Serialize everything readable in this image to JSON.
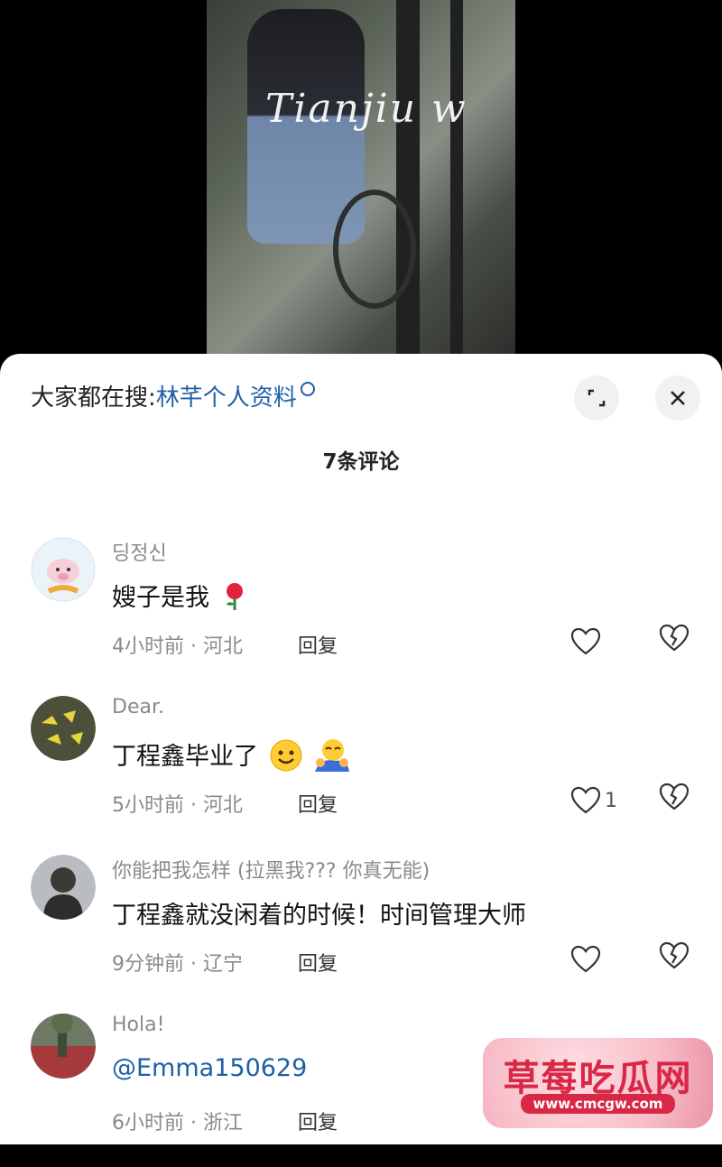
{
  "video": {
    "watermark": "Tianjiu w"
  },
  "sheet": {
    "search_prefix": "大家都在搜:",
    "search_term": "林芊个人资料",
    "expand_icon": "expand-icon",
    "close_icon": "close-icon",
    "comment_count_label": "7条评论"
  },
  "comments": [
    {
      "user": "딩정신",
      "text": "嫂子是我",
      "emoji": "rose",
      "meta": "4小时前 · 河北",
      "reply": "回复",
      "likes": ""
    },
    {
      "user": "Dear.",
      "text": "丁程鑫毕业了",
      "emoji": "grin-hug",
      "meta": "5小时前 · 河北",
      "reply": "回复",
      "likes": "1"
    },
    {
      "user": "你能把我怎样 (拉黑我???  你真无能)",
      "text": "丁程鑫就没闲着的时候！时间管理大师",
      "meta": "9分钟前 · 辽宁",
      "reply": "回复",
      "likes": ""
    },
    {
      "user": "Hola!",
      "text": "@Emma150629",
      "meta": "6小时前 · 浙江",
      "reply": "回复",
      "likes": ""
    }
  ],
  "badge": {
    "title": "草莓吃瓜网",
    "url": "www.cmcgw.com"
  },
  "colors": {
    "link": "#1f5fa8",
    "meta": "#8a8a8a",
    "badge_red": "#d81f3f"
  }
}
